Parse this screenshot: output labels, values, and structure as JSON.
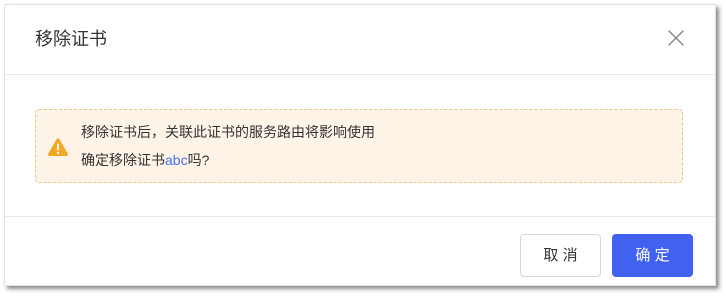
{
  "dialog": {
    "title": "移除证书",
    "close_icon": "close-icon"
  },
  "alert": {
    "icon": "warning-icon",
    "line1": "移除证书后，关联此证书的服务路由将影响使用",
    "line2_prefix": "确定移除证书",
    "line2_name": "abc",
    "line2_suffix": "吗?"
  },
  "footer": {
    "cancel_label": "取 消",
    "confirm_label": "确 定"
  },
  "colors": {
    "primary": "#4161f1",
    "warning": "#f5a623",
    "alert_background": "#fdf3e7",
    "alert_border": "#f2c690",
    "link": "#4a6cf7"
  }
}
